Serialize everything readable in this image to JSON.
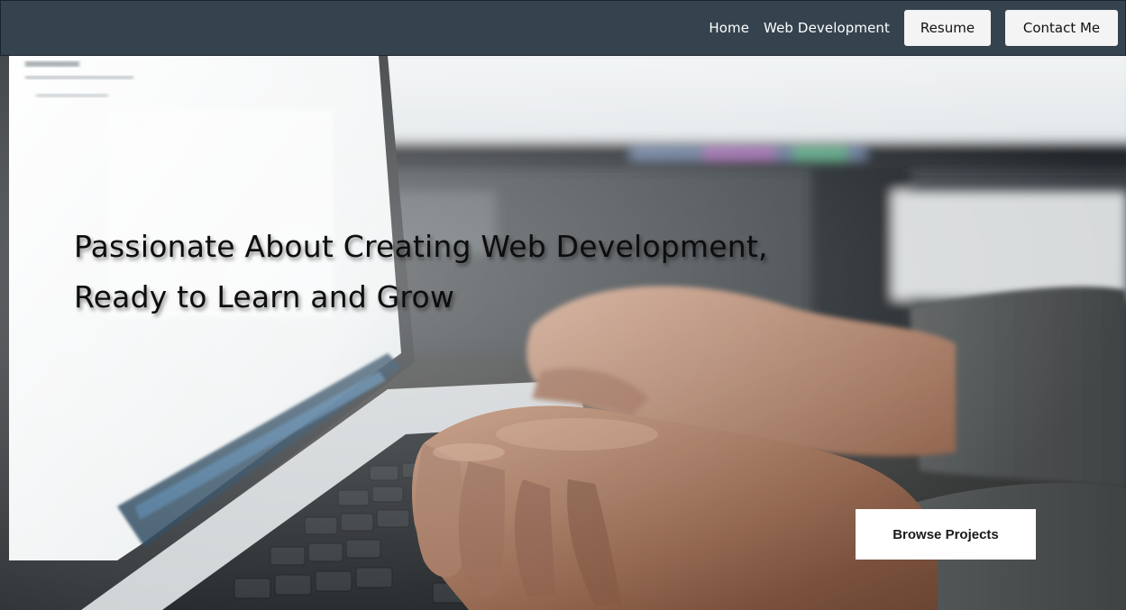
{
  "nav": {
    "home": "Home",
    "web_development": "Web Development",
    "resume": "Resume",
    "contact": "Contact Me"
  },
  "hero": {
    "headline_line1": "Passionate About Creating Web Development,",
    "headline_line2": "Ready to Learn and Grow",
    "cta_label": "Browse Projects",
    "background_image": "laptop-typing-photo"
  },
  "colors": {
    "navbar": "#35434f",
    "button_bg": "#f4f4f4",
    "headline": "#0d0d0d",
    "cta_bg": "#ffffff"
  }
}
